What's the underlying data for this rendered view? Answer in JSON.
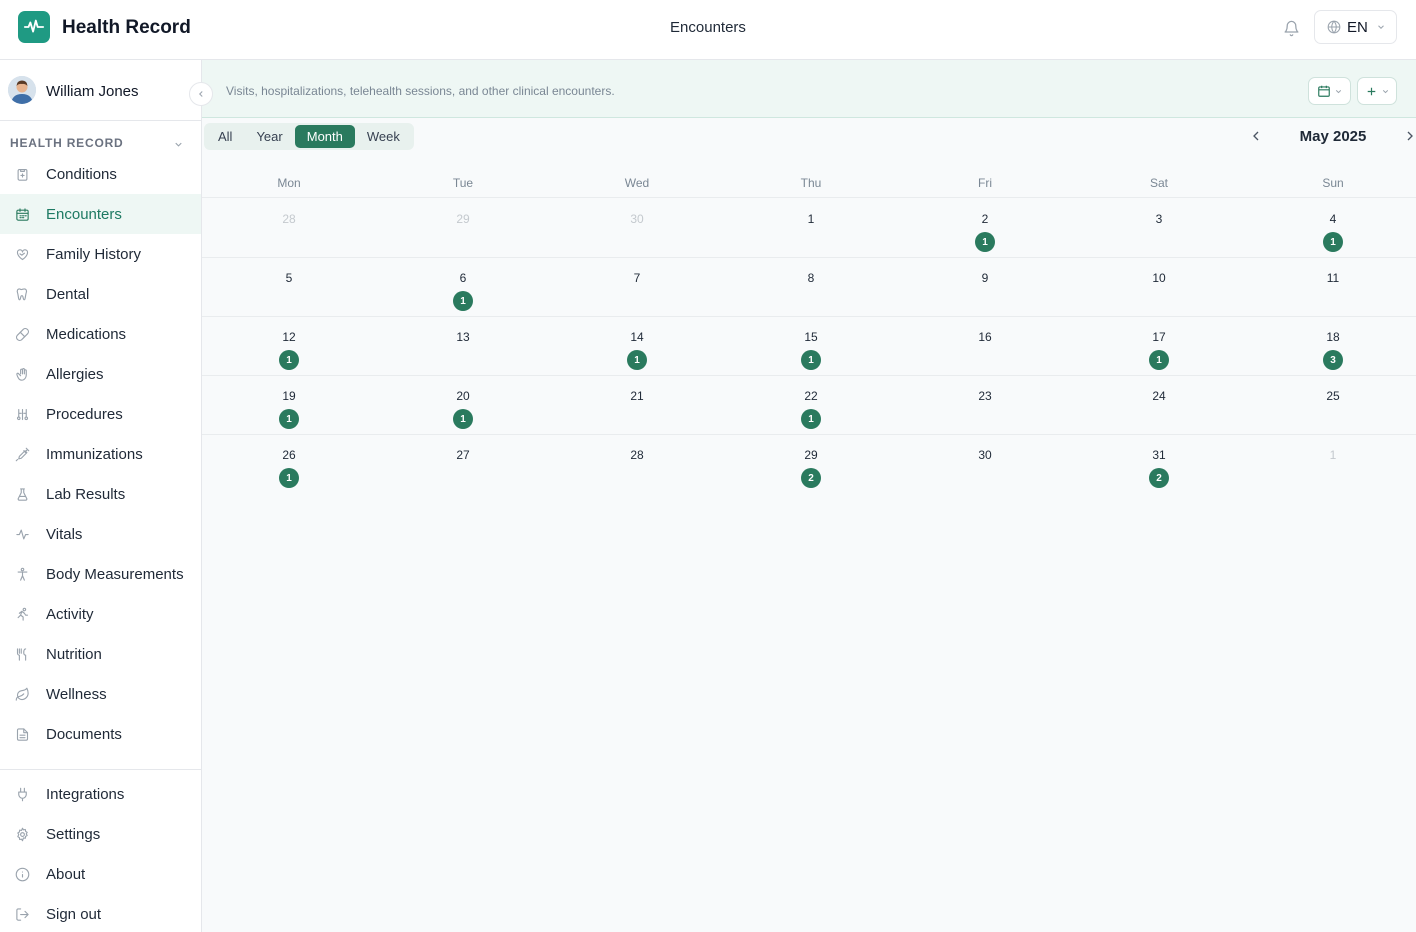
{
  "header": {
    "app_title": "Health Record",
    "page_title": "Encounters",
    "language": "EN"
  },
  "user": {
    "name": "William Jones"
  },
  "sidebar": {
    "section_title": "HEALTH RECORD",
    "items": [
      {
        "label": "Conditions",
        "icon": "clipboard-icon",
        "active": false
      },
      {
        "label": "Encounters",
        "icon": "calendar-icon",
        "active": true
      },
      {
        "label": "Family History",
        "icon": "heart-handshake-icon",
        "active": false
      },
      {
        "label": "Dental",
        "icon": "tooth-icon",
        "active": false
      },
      {
        "label": "Medications",
        "icon": "pill-icon",
        "active": false
      },
      {
        "label": "Allergies",
        "icon": "hand-icon",
        "active": false
      },
      {
        "label": "Procedures",
        "icon": "surgical-tools-icon",
        "active": false
      },
      {
        "label": "Immunizations",
        "icon": "syringe-icon",
        "active": false
      },
      {
        "label": "Lab Results",
        "icon": "flask-icon",
        "active": false
      },
      {
        "label": "Vitals",
        "icon": "pulse-icon",
        "active": false
      },
      {
        "label": "Body Measurements",
        "icon": "body-icon",
        "active": false
      },
      {
        "label": "Activity",
        "icon": "running-icon",
        "active": false
      },
      {
        "label": "Nutrition",
        "icon": "utensils-icon",
        "active": false
      },
      {
        "label": "Wellness",
        "icon": "leaf-icon",
        "active": false
      },
      {
        "label": "Documents",
        "icon": "document-icon",
        "active": false
      }
    ],
    "bottom_items": [
      {
        "label": "Integrations",
        "icon": "plug-icon"
      },
      {
        "label": "Settings",
        "icon": "gear-icon"
      },
      {
        "label": "About",
        "icon": "info-icon"
      },
      {
        "label": "Sign out",
        "icon": "sign-out-icon"
      }
    ]
  },
  "banner": {
    "description": "Visits, hospitalizations, telehealth sessions, and other clinical encounters."
  },
  "view_tabs": [
    {
      "label": "All",
      "active": false
    },
    {
      "label": "Year",
      "active": false
    },
    {
      "label": "Month",
      "active": true
    },
    {
      "label": "Week",
      "active": false
    }
  ],
  "calendar": {
    "month_label": "May 2025",
    "weekdays": [
      "Mon",
      "Tue",
      "Wed",
      "Thu",
      "Fri",
      "Sat",
      "Sun"
    ],
    "weeks": [
      [
        {
          "day": "28",
          "muted": true,
          "count": ""
        },
        {
          "day": "29",
          "muted": true,
          "count": ""
        },
        {
          "day": "30",
          "muted": true,
          "count": ""
        },
        {
          "day": "1",
          "muted": false,
          "count": ""
        },
        {
          "day": "2",
          "muted": false,
          "count": "1"
        },
        {
          "day": "3",
          "muted": false,
          "count": ""
        },
        {
          "day": "4",
          "muted": false,
          "count": "1"
        }
      ],
      [
        {
          "day": "5",
          "muted": false,
          "count": ""
        },
        {
          "day": "6",
          "muted": false,
          "count": "1"
        },
        {
          "day": "7",
          "muted": false,
          "count": ""
        },
        {
          "day": "8",
          "muted": false,
          "count": ""
        },
        {
          "day": "9",
          "muted": false,
          "count": ""
        },
        {
          "day": "10",
          "muted": false,
          "count": ""
        },
        {
          "day": "11",
          "muted": false,
          "count": ""
        }
      ],
      [
        {
          "day": "12",
          "muted": false,
          "count": "1"
        },
        {
          "day": "13",
          "muted": false,
          "count": ""
        },
        {
          "day": "14",
          "muted": false,
          "count": "1"
        },
        {
          "day": "15",
          "muted": false,
          "count": "1"
        },
        {
          "day": "16",
          "muted": false,
          "count": ""
        },
        {
          "day": "17",
          "muted": false,
          "count": "1"
        },
        {
          "day": "18",
          "muted": false,
          "count": "3"
        }
      ],
      [
        {
          "day": "19",
          "muted": false,
          "count": "1"
        },
        {
          "day": "20",
          "muted": false,
          "count": "1"
        },
        {
          "day": "21",
          "muted": false,
          "count": ""
        },
        {
          "day": "22",
          "muted": false,
          "count": "1"
        },
        {
          "day": "23",
          "muted": false,
          "count": ""
        },
        {
          "day": "24",
          "muted": false,
          "count": ""
        },
        {
          "day": "25",
          "muted": false,
          "count": ""
        }
      ],
      [
        {
          "day": "26",
          "muted": false,
          "count": "1"
        },
        {
          "day": "27",
          "muted": false,
          "count": ""
        },
        {
          "day": "28",
          "muted": false,
          "count": ""
        },
        {
          "day": "29",
          "muted": false,
          "count": "2"
        },
        {
          "day": "30",
          "muted": false,
          "count": ""
        },
        {
          "day": "31",
          "muted": false,
          "count": "2"
        },
        {
          "day": "1",
          "muted": true,
          "count": ""
        }
      ]
    ]
  },
  "colors": {
    "brand": "#1f9a83",
    "accent": "#2a7a5e",
    "banner_bg": "#eef7f4"
  }
}
